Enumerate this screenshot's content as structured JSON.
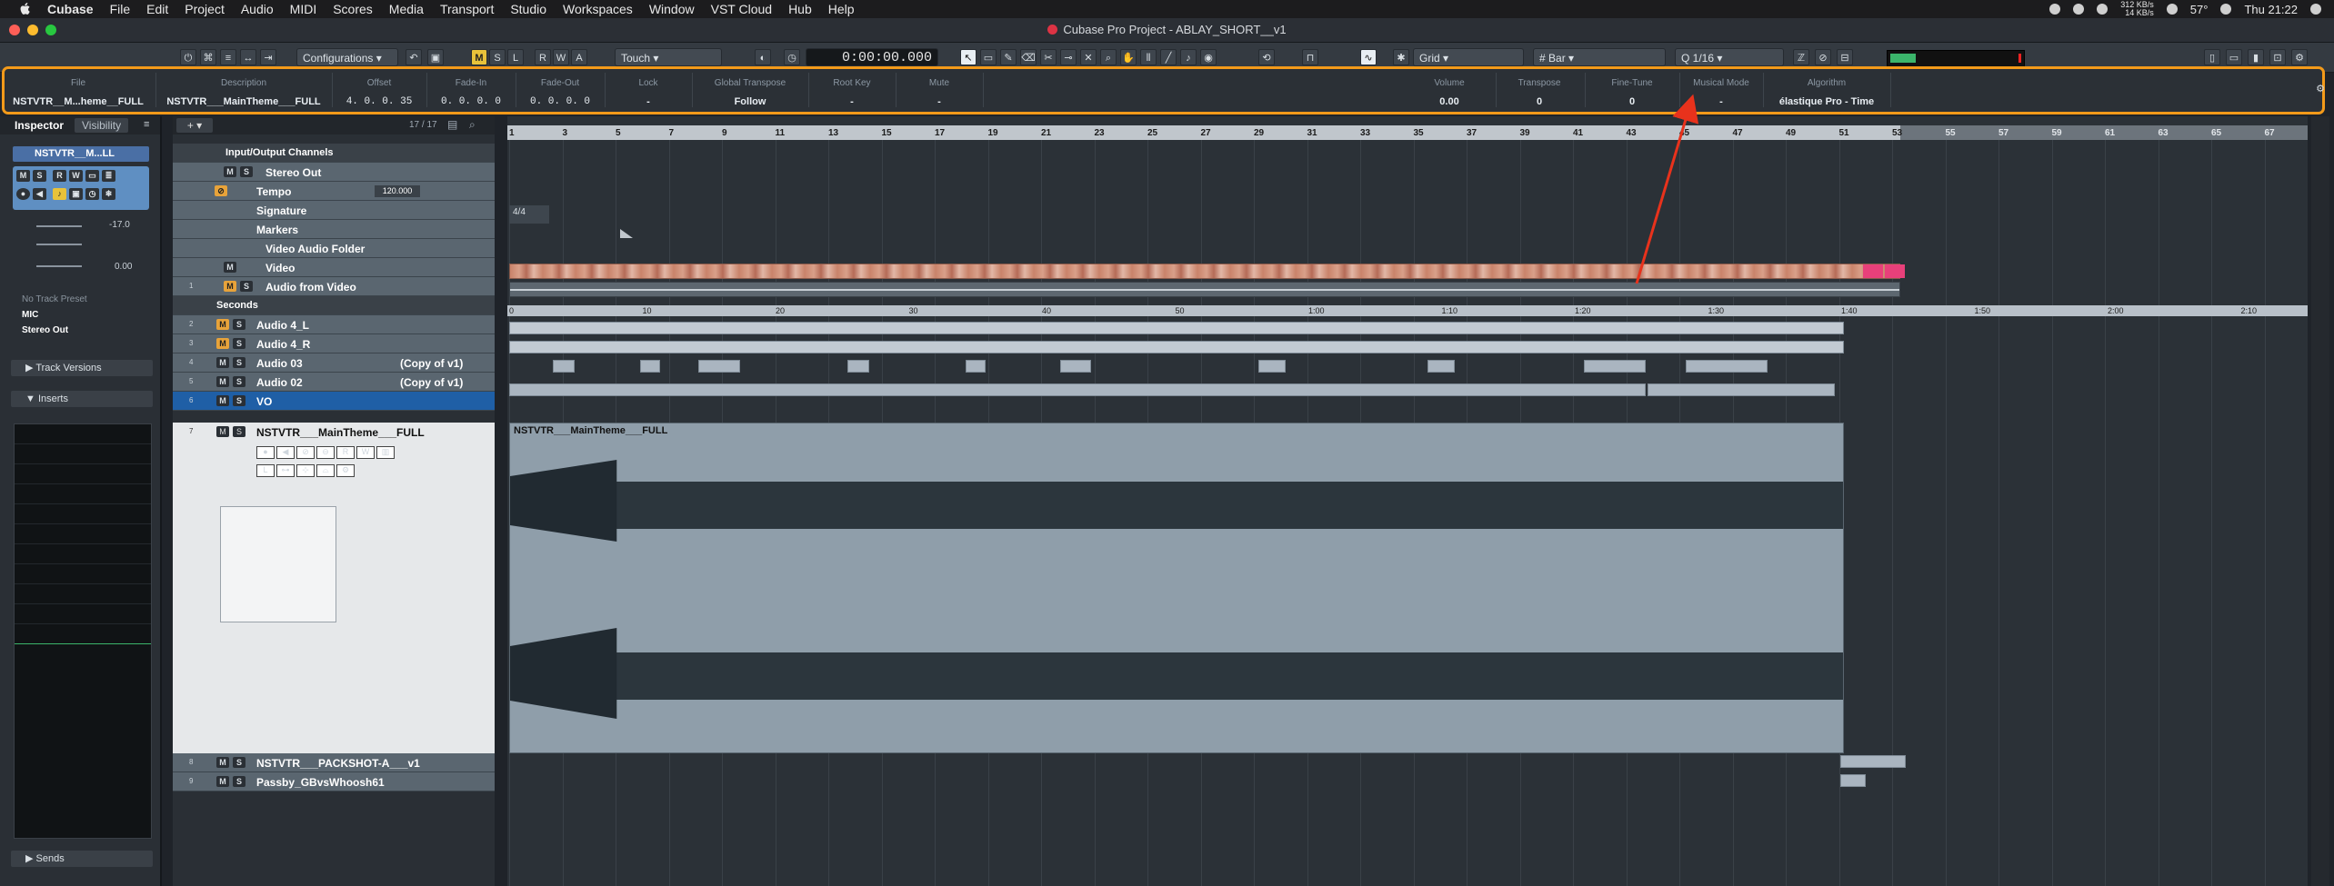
{
  "menubar": {
    "app": "Cubase",
    "items": [
      "File",
      "Edit",
      "Project",
      "Audio",
      "MIDI",
      "Scores",
      "Media",
      "Transport",
      "Studio",
      "Workspaces",
      "Window",
      "VST Cloud",
      "Hub",
      "Help"
    ],
    "net_up": "312 KB/s",
    "net_down": "14 KB/s",
    "temp": "57°",
    "clock": "Thu 21:22"
  },
  "window": {
    "title": "Cubase Pro Project - ABLAY_SHORT__v1"
  },
  "toolbar": {
    "configurations": "Configurations",
    "automation_mode": "Touch",
    "time": "0:00:00.000",
    "snap_type": "Grid",
    "grid": "Bar",
    "quantize": "1/16",
    "buttons": {
      "m": "M",
      "s": "S",
      "l": "L",
      "r": "R",
      "w": "W",
      "a": "A"
    },
    "meter_level": 0.2
  },
  "infoline": {
    "columns": [
      {
        "header": "File",
        "value": "NSTVTR__M...heme__FULL"
      },
      {
        "header": "Description",
        "value": "NSTVTR___MainTheme___FULL"
      },
      {
        "header": "Offset",
        "value": "4. 0. 0. 35"
      },
      {
        "header": "Fade-In",
        "value": "0. 0. 0. 0"
      },
      {
        "header": "Fade-Out",
        "value": "0. 0. 0. 0"
      },
      {
        "header": "Lock",
        "value": "-"
      },
      {
        "header": "Global Transpose",
        "value": "Follow"
      },
      {
        "header": "Root Key",
        "value": "-"
      },
      {
        "header": "Mute",
        "value": "-"
      },
      {
        "header": "Volume",
        "value": "0.00"
      },
      {
        "header": "Transpose",
        "value": "0"
      },
      {
        "header": "Fine-Tune",
        "value": "0"
      },
      {
        "header": "Musical Mode",
        "value": "-"
      },
      {
        "header": "Algorithm",
        "value": "élastique Pro - Time"
      }
    ]
  },
  "inspector": {
    "tabs": [
      "Inspector",
      "Visibility"
    ],
    "track_name": "NSTVTR__M...LL",
    "volume": "-17.0",
    "pan": "0.00",
    "preset": "No Track Preset",
    "input": "MIC",
    "output": "Stereo Out",
    "sections": [
      "Track Versions",
      "Inserts",
      "Sends"
    ]
  },
  "tracklist": {
    "count": "17 / 17",
    "tracks": [
      {
        "num": "",
        "name": "Input/Output Channels",
        "aux": ""
      },
      {
        "num": "",
        "name": "Stereo Out",
        "aux": ""
      },
      {
        "num": "",
        "name": "Tempo",
        "aux": "120.000"
      },
      {
        "num": "",
        "name": "Signature",
        "aux": ""
      },
      {
        "num": "",
        "name": "Markers",
        "aux": ""
      },
      {
        "num": "",
        "name": "Video Audio Folder",
        "aux": ""
      },
      {
        "num": "",
        "name": "Video",
        "aux": ""
      },
      {
        "num": "1",
        "name": "Audio from Video",
        "aux": ""
      },
      {
        "num": "",
        "name": "Seconds",
        "aux": ""
      },
      {
        "num": "2",
        "name": "Audio 4_L",
        "aux": ""
      },
      {
        "num": "3",
        "name": "Audio 4_R",
        "aux": ""
      },
      {
        "num": "4",
        "name": "Audio 03",
        "aux": "(Copy of v1)"
      },
      {
        "num": "5",
        "name": "Audio 02",
        "aux": "(Copy of v1)"
      },
      {
        "num": "6",
        "name": "VO",
        "aux": ""
      },
      {
        "num": "7",
        "name": "NSTVTR___MainTheme___FULL",
        "aux": ""
      },
      {
        "num": "8",
        "name": "NSTVTR___PACKSHOT-A___v1",
        "aux": ""
      },
      {
        "num": "9",
        "name": "Passby_GBvsWhoosh61",
        "aux": ""
      }
    ]
  },
  "arrange": {
    "bars": [
      "1",
      "3",
      "5",
      "7",
      "9",
      "11",
      "13",
      "15",
      "17",
      "19",
      "21",
      "23",
      "25",
      "27",
      "29",
      "31",
      "33",
      "35",
      "37",
      "39",
      "41",
      "43",
      "45",
      "47",
      "49",
      "51",
      "53",
      "55",
      "57",
      "59",
      "61",
      "63",
      "65",
      "67"
    ],
    "seconds": [
      "0",
      "10",
      "20",
      "30",
      "40",
      "50",
      "1:00",
      "1:10",
      "1:20",
      "1:30",
      "1:40",
      "1:50",
      "2:00",
      "2:10"
    ],
    "time_signature": "4/4",
    "clip_label": "NSTVTR___MainTheme___FULL"
  },
  "colors": {
    "accent": "#f39a1a",
    "selected_track": "#1f5fa6",
    "arrow": "#e8321c"
  }
}
